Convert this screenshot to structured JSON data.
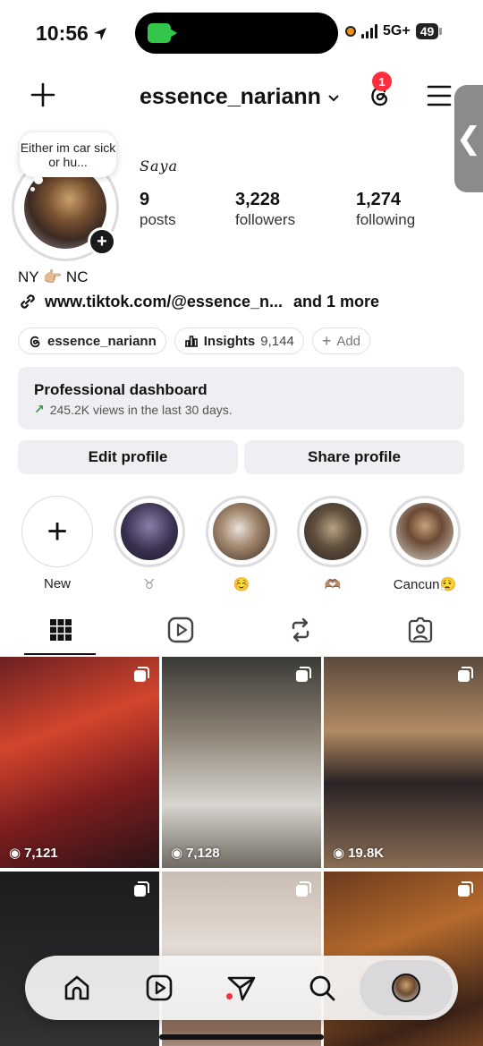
{
  "status_bar": {
    "time": "10:56",
    "network": "5G+",
    "battery": "49"
  },
  "header": {
    "username": "essence_nariann",
    "notification_count": "1"
  },
  "profile": {
    "note": "Either im car sick or hu...",
    "display_name": "Saya",
    "stats": [
      {
        "value": "9",
        "label": "posts"
      },
      {
        "value": "3,228",
        "label": "followers"
      },
      {
        "value": "1,274",
        "label": "following"
      }
    ],
    "bio": "NY 👉🏼 NC",
    "link": "www.tiktok.com/@essence_n...",
    "link_more": "and 1 more"
  },
  "chips": {
    "threads": "essence_nariann",
    "insights_label": "Insights",
    "insights_value": "9,144",
    "add": "Add"
  },
  "dashboard": {
    "title": "Professional dashboard",
    "subtitle": "245.2K views in the last 30 days."
  },
  "buttons": {
    "edit": "Edit profile",
    "share": "Share profile"
  },
  "highlights": [
    {
      "label": "New"
    },
    {
      "label": "♉"
    },
    {
      "label": "☺️"
    },
    {
      "label": "🫶🏽"
    },
    {
      "label": "Cancun😮‍💨"
    }
  ],
  "grid_views": [
    "7,121",
    "7,128",
    "19.8K"
  ],
  "colors": {
    "accent_red": "#ff2d3e",
    "trend_green": "#2aa046",
    "surface": "#efeff3"
  }
}
